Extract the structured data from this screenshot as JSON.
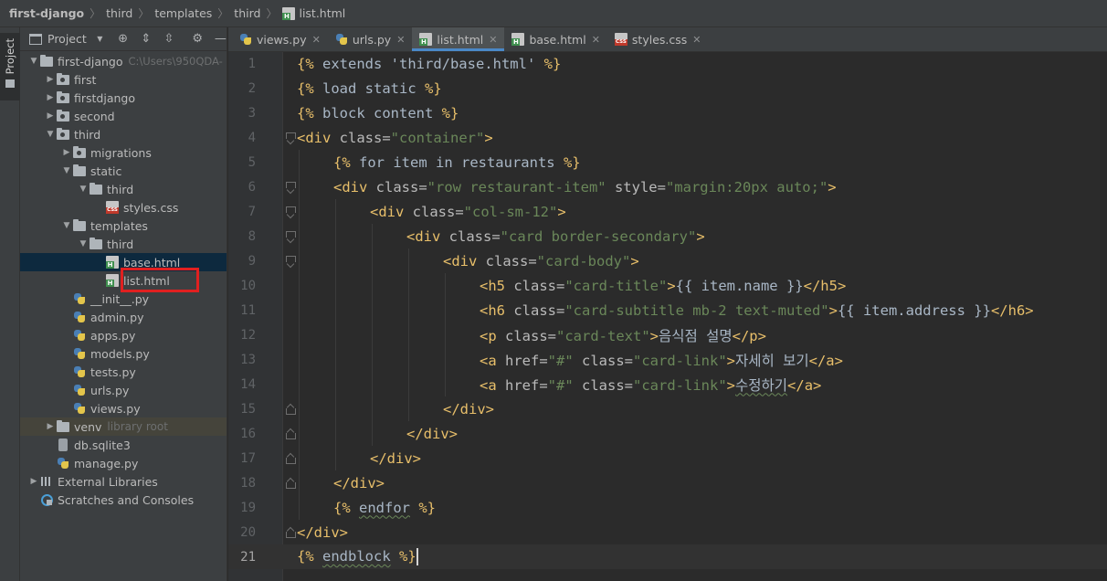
{
  "breadcrumb": [
    {
      "label": "first-django",
      "icon": "folder-icon"
    },
    {
      "label": "third",
      "icon": "folder-icon"
    },
    {
      "label": "templates",
      "icon": "folder-icon"
    },
    {
      "label": "third",
      "icon": "folder-icon"
    },
    {
      "label": "list.html",
      "icon": "html-file-icon"
    }
  ],
  "toolstrip": {
    "project_tab_label": "Project"
  },
  "project_panel": {
    "title": "Project",
    "tree": [
      {
        "label": "first-django",
        "hint": "C:\\Users\\950QDA-",
        "depth": 0,
        "kind": "folder",
        "expanded": true
      },
      {
        "label": "first",
        "depth": 1,
        "kind": "folder-dot",
        "expanded": false
      },
      {
        "label": "firstdjango",
        "depth": 1,
        "kind": "folder-dot",
        "expanded": false
      },
      {
        "label": "second",
        "depth": 1,
        "kind": "folder-dot",
        "expanded": false
      },
      {
        "label": "third",
        "depth": 1,
        "kind": "folder-dot",
        "expanded": true
      },
      {
        "label": "migrations",
        "depth": 2,
        "kind": "folder-dot",
        "expanded": false
      },
      {
        "label": "static",
        "depth": 2,
        "kind": "folder",
        "expanded": true
      },
      {
        "label": "third",
        "depth": 3,
        "kind": "folder",
        "expanded": true
      },
      {
        "label": "styles.css",
        "depth": 4,
        "kind": "css"
      },
      {
        "label": "templates",
        "depth": 2,
        "kind": "folder",
        "expanded": true
      },
      {
        "label": "third",
        "depth": 3,
        "kind": "folder",
        "expanded": true
      },
      {
        "label": "base.html",
        "depth": 4,
        "kind": "html",
        "selected": true
      },
      {
        "label": "list.html",
        "depth": 4,
        "kind": "html",
        "highlighted": true
      },
      {
        "label": "__init__.py",
        "depth": 2,
        "kind": "py"
      },
      {
        "label": "admin.py",
        "depth": 2,
        "kind": "py"
      },
      {
        "label": "apps.py",
        "depth": 2,
        "kind": "py"
      },
      {
        "label": "models.py",
        "depth": 2,
        "kind": "py"
      },
      {
        "label": "tests.py",
        "depth": 2,
        "kind": "py"
      },
      {
        "label": "urls.py",
        "depth": 2,
        "kind": "py"
      },
      {
        "label": "views.py",
        "depth": 2,
        "kind": "py"
      },
      {
        "label": "venv",
        "hint": "library root",
        "depth": 1,
        "kind": "folder",
        "expanded": false,
        "lib": true
      },
      {
        "label": "db.sqlite3",
        "depth": 1,
        "kind": "db"
      },
      {
        "label": "manage.py",
        "depth": 1,
        "kind": "py"
      },
      {
        "label": "External Libraries",
        "depth": 0,
        "kind": "lib",
        "expanded": false
      },
      {
        "label": "Scratches and Consoles",
        "depth": 0,
        "kind": "scratch"
      }
    ]
  },
  "tabs": [
    {
      "label": "views.py",
      "kind": "py"
    },
    {
      "label": "urls.py",
      "kind": "py"
    },
    {
      "label": "list.html",
      "kind": "html",
      "active": true
    },
    {
      "label": "base.html",
      "kind": "html"
    },
    {
      "label": "styles.css",
      "kind": "css"
    }
  ],
  "editor": {
    "current_line": 21,
    "lines": [
      {
        "n": "1",
        "indent": 0,
        "parts": [
          [
            "tpl",
            "{% "
          ],
          [
            "tpl-in",
            "extends 'third/base.html' "
          ],
          [
            "tpl",
            "%}"
          ]
        ]
      },
      {
        "n": "2",
        "indent": 0,
        "parts": [
          [
            "tpl",
            "{% "
          ],
          [
            "tpl-in",
            "load static "
          ],
          [
            "tpl",
            "%}"
          ]
        ]
      },
      {
        "n": "3",
        "indent": 0,
        "parts": [
          [
            "tpl",
            "{% "
          ],
          [
            "tpl-in",
            "block content "
          ],
          [
            "tpl",
            "%}"
          ]
        ]
      },
      {
        "n": "4",
        "indent": 0,
        "fold": "open",
        "parts": [
          [
            "tag",
            "<div "
          ],
          [
            "attr",
            "class="
          ],
          [
            "str",
            "\"container\""
          ],
          [
            "tag",
            ">"
          ]
        ]
      },
      {
        "n": "5",
        "indent": 1,
        "parts": [
          [
            "tpl",
            "{% "
          ],
          [
            "tpl-in",
            "for item in restaurants "
          ],
          [
            "tpl",
            "%}"
          ]
        ]
      },
      {
        "n": "6",
        "indent": 1,
        "fold": "open",
        "parts": [
          [
            "tag",
            "<div "
          ],
          [
            "attr",
            "class="
          ],
          [
            "str",
            "\"row restaurant-item\""
          ],
          [
            "attr",
            " style="
          ],
          [
            "str",
            "\"margin:20px auto;\""
          ],
          [
            "tag",
            ">"
          ]
        ]
      },
      {
        "n": "7",
        "indent": 2,
        "fold": "open",
        "parts": [
          [
            "tag",
            "<div "
          ],
          [
            "attr",
            "class="
          ],
          [
            "str",
            "\"col-sm-12\""
          ],
          [
            "tag",
            ">"
          ]
        ]
      },
      {
        "n": "8",
        "indent": 3,
        "fold": "open",
        "parts": [
          [
            "tag",
            "<div "
          ],
          [
            "attr",
            "class="
          ],
          [
            "str",
            "\"card border-secondary\""
          ],
          [
            "tag",
            ">"
          ]
        ]
      },
      {
        "n": "9",
        "indent": 4,
        "fold": "open",
        "parts": [
          [
            "tag",
            "<div "
          ],
          [
            "attr",
            "class="
          ],
          [
            "str",
            "\"card-body\""
          ],
          [
            "tag",
            ">"
          ]
        ]
      },
      {
        "n": "10",
        "indent": 5,
        "parts": [
          [
            "tag",
            "<h5 "
          ],
          [
            "attr",
            "class="
          ],
          [
            "str",
            "\"card-title\""
          ],
          [
            "tag",
            ">"
          ],
          [
            "txt",
            "{{ item.name }}"
          ],
          [
            "tag",
            "</h5>"
          ]
        ]
      },
      {
        "n": "11",
        "indent": 5,
        "parts": [
          [
            "tag",
            "<h6 "
          ],
          [
            "attr",
            "class="
          ],
          [
            "str",
            "\"card-subtitle mb-2 text-muted\""
          ],
          [
            "tag",
            ">"
          ],
          [
            "txt",
            "{{ item.address }}"
          ],
          [
            "tag",
            "</h6>"
          ]
        ]
      },
      {
        "n": "12",
        "indent": 5,
        "parts": [
          [
            "tag",
            "<p "
          ],
          [
            "attr",
            "class="
          ],
          [
            "str",
            "\"card-text\""
          ],
          [
            "tag",
            ">"
          ],
          [
            "txt",
            "음식점 설명"
          ],
          [
            "tag",
            "</p>"
          ]
        ]
      },
      {
        "n": "13",
        "indent": 5,
        "parts": [
          [
            "tag",
            "<a "
          ],
          [
            "attr",
            "href="
          ],
          [
            "str",
            "\"#\""
          ],
          [
            "attr",
            " class="
          ],
          [
            "str",
            "\"card-link\""
          ],
          [
            "tag",
            ">"
          ],
          [
            "txt",
            "자세히 보기"
          ],
          [
            "tag",
            "</a>"
          ]
        ]
      },
      {
        "n": "14",
        "indent": 5,
        "parts": [
          [
            "tag",
            "<a "
          ],
          [
            "attr",
            "href="
          ],
          [
            "str",
            "\"#\""
          ],
          [
            "attr",
            " class="
          ],
          [
            "str",
            "\"card-link\""
          ],
          [
            "tag",
            ">"
          ],
          [
            "txt-squig",
            "수정하기"
          ],
          [
            "tag",
            "</a>"
          ]
        ]
      },
      {
        "n": "15",
        "indent": 4,
        "fold": "close",
        "parts": [
          [
            "tag",
            "</div>"
          ]
        ]
      },
      {
        "n": "16",
        "indent": 3,
        "fold": "close",
        "parts": [
          [
            "tag",
            "</div>"
          ]
        ]
      },
      {
        "n": "17",
        "indent": 2,
        "fold": "close",
        "parts": [
          [
            "tag",
            "</div>"
          ]
        ]
      },
      {
        "n": "18",
        "indent": 1,
        "fold": "close",
        "parts": [
          [
            "tag",
            "</div>"
          ]
        ]
      },
      {
        "n": "19",
        "indent": 1,
        "parts": [
          [
            "tpl",
            "{% "
          ],
          [
            "tpl-in-squig",
            "endfor"
          ],
          [
            "tpl-in",
            " "
          ],
          [
            "tpl",
            "%}"
          ]
        ]
      },
      {
        "n": "20",
        "indent": 0,
        "fold": "close",
        "parts": [
          [
            "tag",
            "</div>"
          ]
        ]
      },
      {
        "n": "21",
        "indent": 0,
        "caret": true,
        "parts": [
          [
            "tpl",
            "{% "
          ],
          [
            "tpl-in-squig",
            "endblock"
          ],
          [
            "tpl-in",
            " "
          ],
          [
            "tpl",
            "%}"
          ]
        ]
      }
    ]
  },
  "colors": {
    "accent": "#4a88c7",
    "highlight_box": "#e02020",
    "tag": "#e8bf6a",
    "string": "#6a8759",
    "text": "#a9b7c6"
  }
}
